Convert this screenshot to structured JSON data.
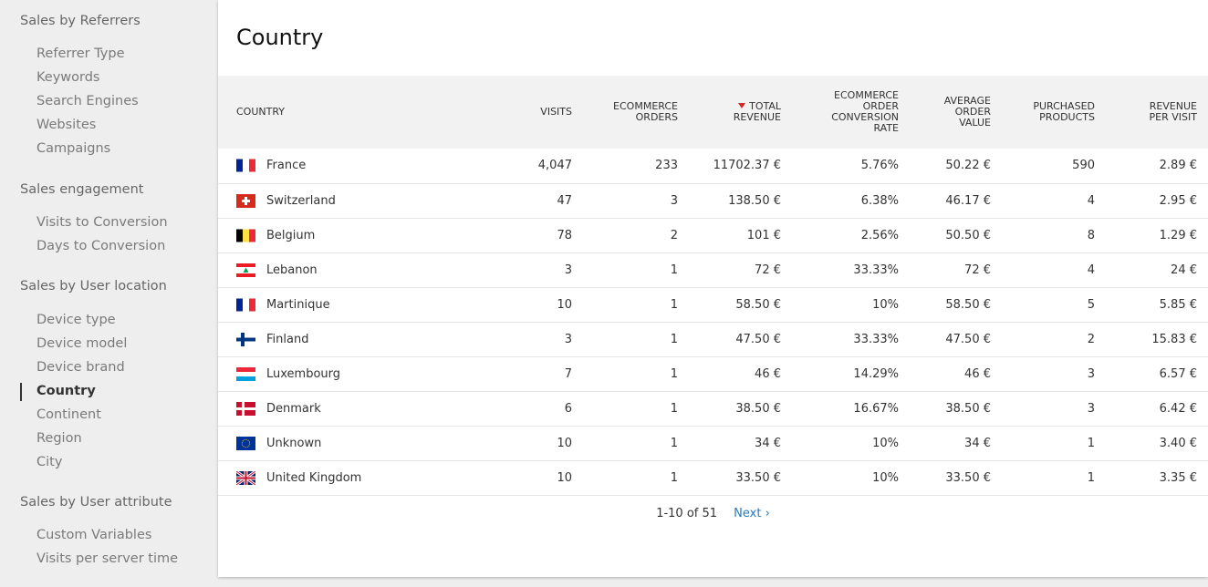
{
  "sidebar": {
    "groups": [
      {
        "title": "Sales by Referrers",
        "items": [
          "Referrer Type",
          "Keywords",
          "Search Engines",
          "Websites",
          "Campaigns"
        ]
      },
      {
        "title": "Sales engagement",
        "items": [
          "Visits to Conversion",
          "Days to Conversion"
        ]
      },
      {
        "title": "Sales by User location",
        "items": [
          "Device type",
          "Device model",
          "Device brand",
          "Country",
          "Continent",
          "Region",
          "City"
        ]
      },
      {
        "title": "Sales by User attribute",
        "items": [
          "Custom Variables",
          "Visits per server time"
        ]
      }
    ],
    "active_item": "Country"
  },
  "report": {
    "title": "Country",
    "columns": {
      "country": "COUNTRY",
      "visits": "VISITS",
      "orders_1": "ECOMMERCE",
      "orders_2": "ORDERS",
      "revenue_1": "TOTAL",
      "revenue_2": "REVENUE",
      "conv_1": "ECOMMERCE",
      "conv_2": "ORDER",
      "conv_3": "CONVERSION",
      "conv_4": "RATE",
      "aov_1": "AVERAGE",
      "aov_2": "ORDER",
      "aov_3": "VALUE",
      "products_1": "PURCHASED",
      "products_2": "PRODUCTS",
      "rpv_1": "REVENUE",
      "rpv_2": "PER VISIT"
    },
    "sort_column": "revenue",
    "sort_color": "#d4291f",
    "rows": [
      {
        "flag": "fr",
        "country": "France",
        "visits": "4,047",
        "orders": "233",
        "revenue": "11702.37 €",
        "conversion": "5.76%",
        "aov": "50.22 €",
        "products": "590",
        "rpv": "2.89 €"
      },
      {
        "flag": "ch",
        "country": "Switzerland",
        "visits": "47",
        "orders": "3",
        "revenue": "138.50 €",
        "conversion": "6.38%",
        "aov": "46.17 €",
        "products": "4",
        "rpv": "2.95 €"
      },
      {
        "flag": "be",
        "country": "Belgium",
        "visits": "78",
        "orders": "2",
        "revenue": "101 €",
        "conversion": "2.56%",
        "aov": "50.50 €",
        "products": "8",
        "rpv": "1.29 €"
      },
      {
        "flag": "lb",
        "country": "Lebanon",
        "visits": "3",
        "orders": "1",
        "revenue": "72 €",
        "conversion": "33.33%",
        "aov": "72 €",
        "products": "4",
        "rpv": "24 €"
      },
      {
        "flag": "mq",
        "country": "Martinique",
        "visits": "10",
        "orders": "1",
        "revenue": "58.50 €",
        "conversion": "10%",
        "aov": "58.50 €",
        "products": "5",
        "rpv": "5.85 €"
      },
      {
        "flag": "fi",
        "country": "Finland",
        "visits": "3",
        "orders": "1",
        "revenue": "47.50 €",
        "conversion": "33.33%",
        "aov": "47.50 €",
        "products": "2",
        "rpv": "15.83 €"
      },
      {
        "flag": "lu",
        "country": "Luxembourg",
        "visits": "7",
        "orders": "1",
        "revenue": "46 €",
        "conversion": "14.29%",
        "aov": "46 €",
        "products": "3",
        "rpv": "6.57 €"
      },
      {
        "flag": "dk",
        "country": "Denmark",
        "visits": "6",
        "orders": "1",
        "revenue": "38.50 €",
        "conversion": "16.67%",
        "aov": "38.50 €",
        "products": "3",
        "rpv": "6.42 €"
      },
      {
        "flag": "eu",
        "country": "Unknown",
        "visits": "10",
        "orders": "1",
        "revenue": "34 €",
        "conversion": "10%",
        "aov": "34 €",
        "products": "1",
        "rpv": "3.40 €"
      },
      {
        "flag": "gb",
        "country": "United Kingdom",
        "visits": "10",
        "orders": "1",
        "revenue": "33.50 €",
        "conversion": "10%",
        "aov": "33.50 €",
        "products": "1",
        "rpv": "3.35 €"
      }
    ],
    "pagination": {
      "range": "1-10 of 51",
      "next": "Next ›"
    }
  }
}
